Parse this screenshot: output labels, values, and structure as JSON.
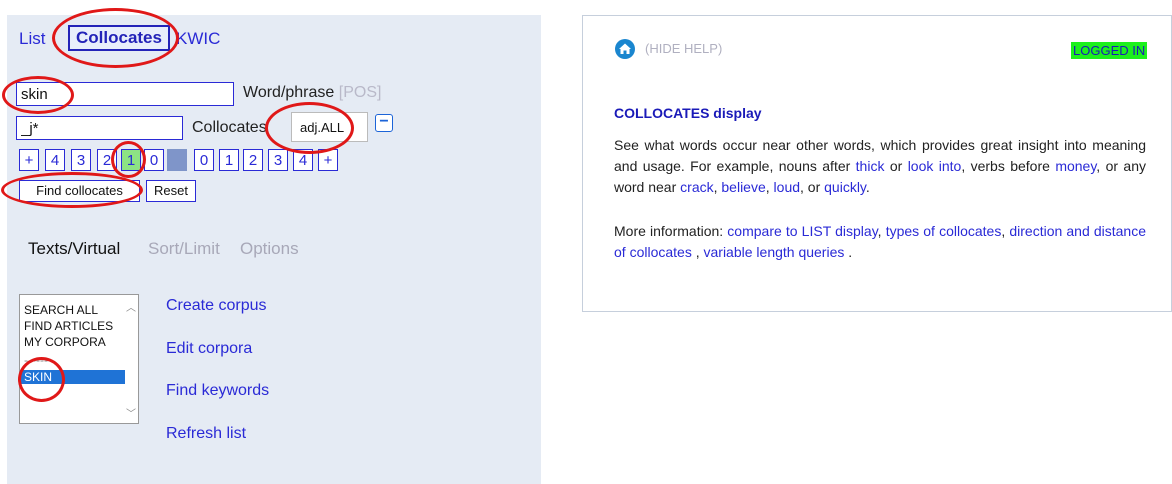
{
  "nav": {
    "list": "List",
    "collocates": "Collocates",
    "kwic": "KWIC"
  },
  "search": {
    "word_value": "skin",
    "word_label": "Word/phrase",
    "pos_label": "[POS]",
    "collocate_value": "_j*",
    "collocate_label": "Collocates",
    "collocate_pos": "adj.ALL",
    "minus": "−"
  },
  "span": {
    "left": [
      "+",
      "4",
      "3",
      "2",
      "1",
      "0"
    ],
    "right": [
      "0",
      "1",
      "2",
      "3",
      "4",
      "+"
    ]
  },
  "buttons": {
    "find": "Find collocates",
    "reset": "Reset"
  },
  "tabs": {
    "texts": "Texts/Virtual",
    "sort": "Sort/Limit",
    "options": "Options"
  },
  "corpora": {
    "items": [
      "SEARCH ALL",
      "FIND ARTICLES",
      "MY CORPORA",
      "------",
      "SKIN"
    ],
    "selected": "SKIN"
  },
  "corpus_links": [
    "Create corpus",
    "Edit corpora",
    "Find keywords",
    "Refresh list"
  ],
  "help": {
    "hide": "(HIDE HELP)",
    "status": "LOGGED IN",
    "heading": "COLLOCATES display",
    "p1_parts": [
      "See what words occur near other words, which provides great insight into meaning and usage. For example, nouns after ",
      "thick",
      " or ",
      "look into",
      ", verbs before ",
      "money",
      ", or any word near ",
      "crack",
      ", ",
      "believe",
      ", ",
      "loud",
      ", or ",
      "quickly",
      "."
    ],
    "p2_parts": [
      "More information: ",
      "compare to LIST display",
      ", ",
      "types of collocates",
      ", ",
      "direction and distance of collocates",
      " , ",
      "variable length queries",
      " ."
    ]
  },
  "colors": {
    "link": "#2a2ad6",
    "panel": "#e5ebf4",
    "status_bg": "#1cf01c",
    "annotation": "#e01818"
  }
}
